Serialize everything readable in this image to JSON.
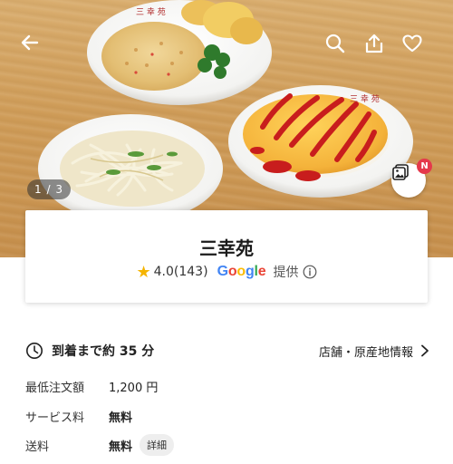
{
  "hero": {
    "photo_subject": "food-photo",
    "counter": "1 / 3",
    "gallery_badge": "N",
    "icons": {
      "back": "arrow-left-icon",
      "search": "search-icon",
      "share": "share-icon",
      "favorite": "heart-icon",
      "gallery": "photo-gallery-icon"
    }
  },
  "store": {
    "name": "三幸苑",
    "rating": "4.0(143)",
    "rating_source": [
      "G",
      "o",
      "o",
      "g",
      "l",
      "e"
    ],
    "provided_label": "提供"
  },
  "details": {
    "delivery_time": "到着まで約 35 分",
    "store_info_link": "店舗・原産地情報",
    "rows": {
      "min_order": {
        "label": "最低注文額",
        "value": "1,200 円"
      },
      "service_fee": {
        "label": "サービス料",
        "value": "無料"
      },
      "delivery_fee": {
        "label": "送料",
        "value": "無料",
        "detail": "詳細"
      }
    }
  },
  "colors": {
    "star": "#f5b400",
    "badge": "#e5384b",
    "google_blue": "#4285f4",
    "google_red": "#ea4335",
    "google_yellow": "#fbbc05",
    "google_green": "#34a853"
  }
}
